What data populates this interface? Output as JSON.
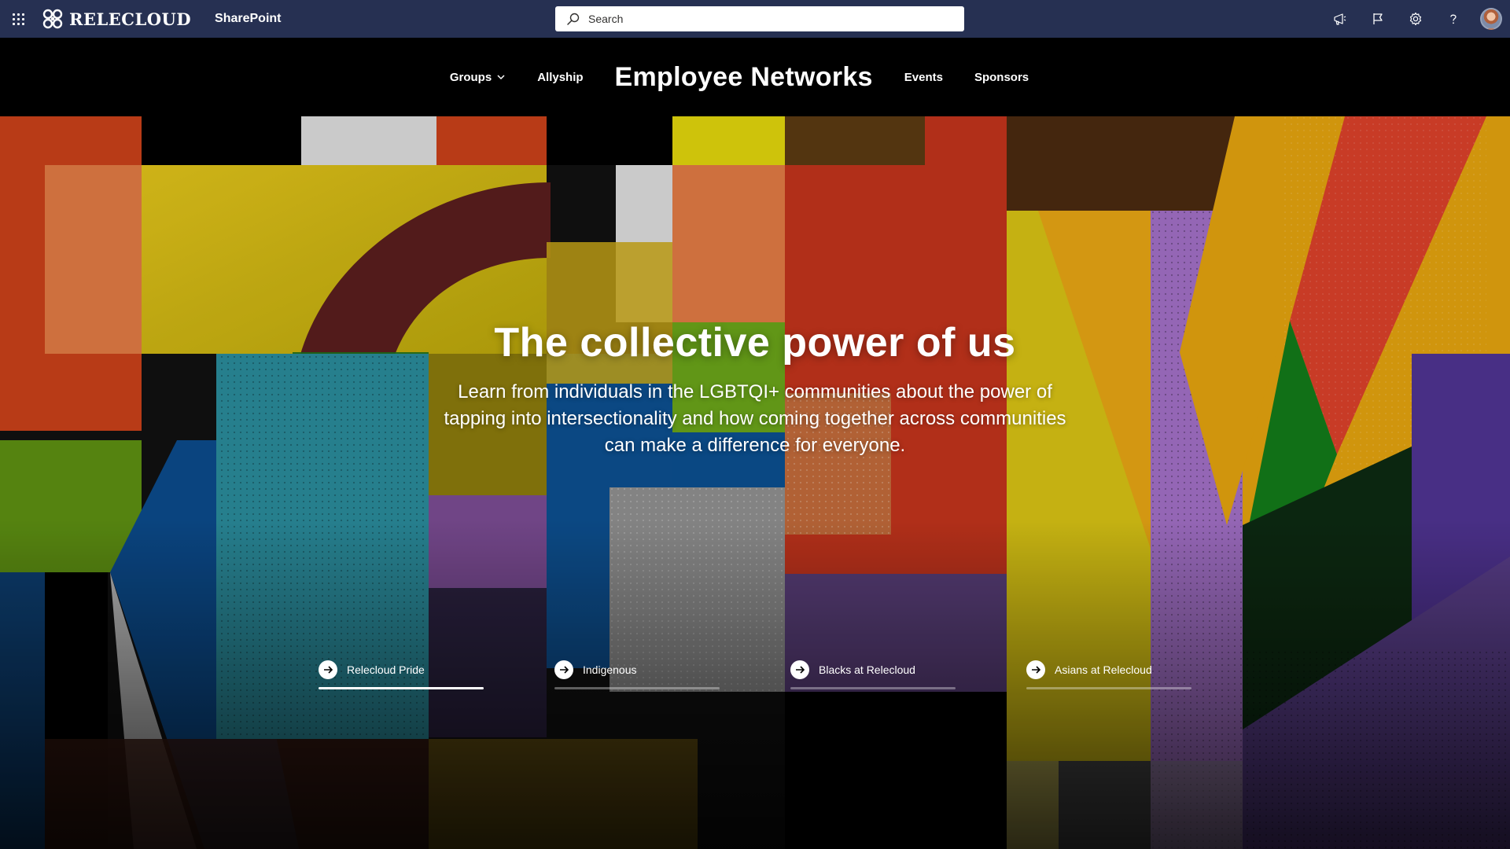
{
  "suitebar": {
    "brand": "RELECLOUD",
    "app_name": "SharePoint",
    "search_placeholder": "Search",
    "icons": [
      "megaphone-icon",
      "flag-icon",
      "settings-gear-icon",
      "help-icon",
      "user-avatar"
    ]
  },
  "nav": {
    "groups": "Groups",
    "allyship": "Allyship",
    "title": "Employee Networks",
    "events": "Events",
    "sponsors": "Sponsors"
  },
  "hero": {
    "title": "The collective power of us",
    "subtitle": "Learn from individuals in the LGBTQI+ communities about the power of tapping into intersectionality and how coming together across communities can make a difference for everyone."
  },
  "tiles": [
    {
      "label": "Relecloud Pride",
      "active": true
    },
    {
      "label": "Indigenous",
      "active": false
    },
    {
      "label": "Blacks at Relecloud",
      "active": false
    },
    {
      "label": "Asians at Relecloud",
      "active": false
    }
  ],
  "colors": {
    "suitebar_bg": "#263052",
    "nav_bg": "#000000",
    "text": "#ffffff"
  }
}
